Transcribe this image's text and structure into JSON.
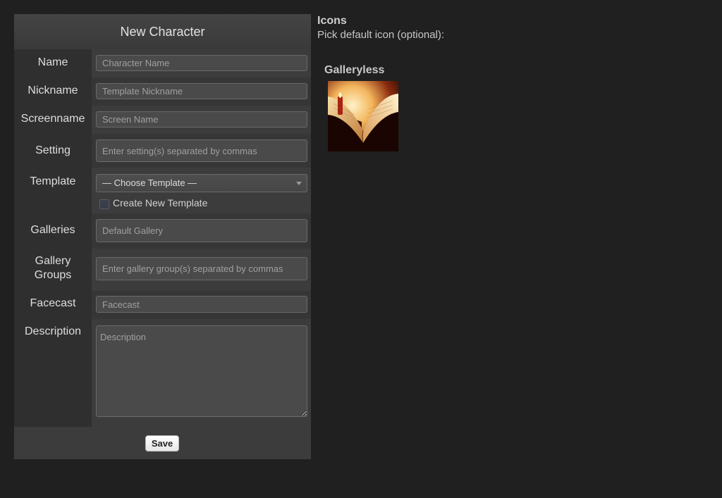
{
  "form": {
    "title": "New Character",
    "fields": {
      "name": {
        "label": "Name",
        "placeholder": "Character Name",
        "value": ""
      },
      "nickname": {
        "label": "Nickname",
        "placeholder": "Template Nickname",
        "value": ""
      },
      "screenname": {
        "label": "Screenname",
        "placeholder": "Screen Name",
        "value": ""
      },
      "setting": {
        "label": "Setting",
        "placeholder": "Enter setting(s) separated by commas",
        "value": ""
      },
      "template": {
        "label": "Template",
        "selected": "— Choose Template —",
        "create_new_label": "Create New Template",
        "create_new_checked": false
      },
      "galleries": {
        "label": "Galleries",
        "placeholder": "Default Gallery",
        "value": ""
      },
      "gallery_groups": {
        "label_line1": "Gallery",
        "label_line2": "Groups",
        "placeholder": "Enter gallery group(s) separated by commas",
        "value": ""
      },
      "facecast": {
        "label": "Facecast",
        "placeholder": "Facecast",
        "value": ""
      },
      "description": {
        "label": "Description",
        "placeholder": "Description",
        "value": ""
      }
    },
    "save_label": "Save"
  },
  "icons": {
    "title": "Icons",
    "subtitle": "Pick default icon (optional):",
    "galleries": [
      {
        "name": "Galleryless",
        "icons": [
          {
            "icon": "open-book-candle-image"
          }
        ]
      }
    ]
  },
  "colors": {
    "background": "#202020",
    "panel": "#2e2e2e",
    "header": "#404040",
    "input": "#4a4a4a"
  }
}
